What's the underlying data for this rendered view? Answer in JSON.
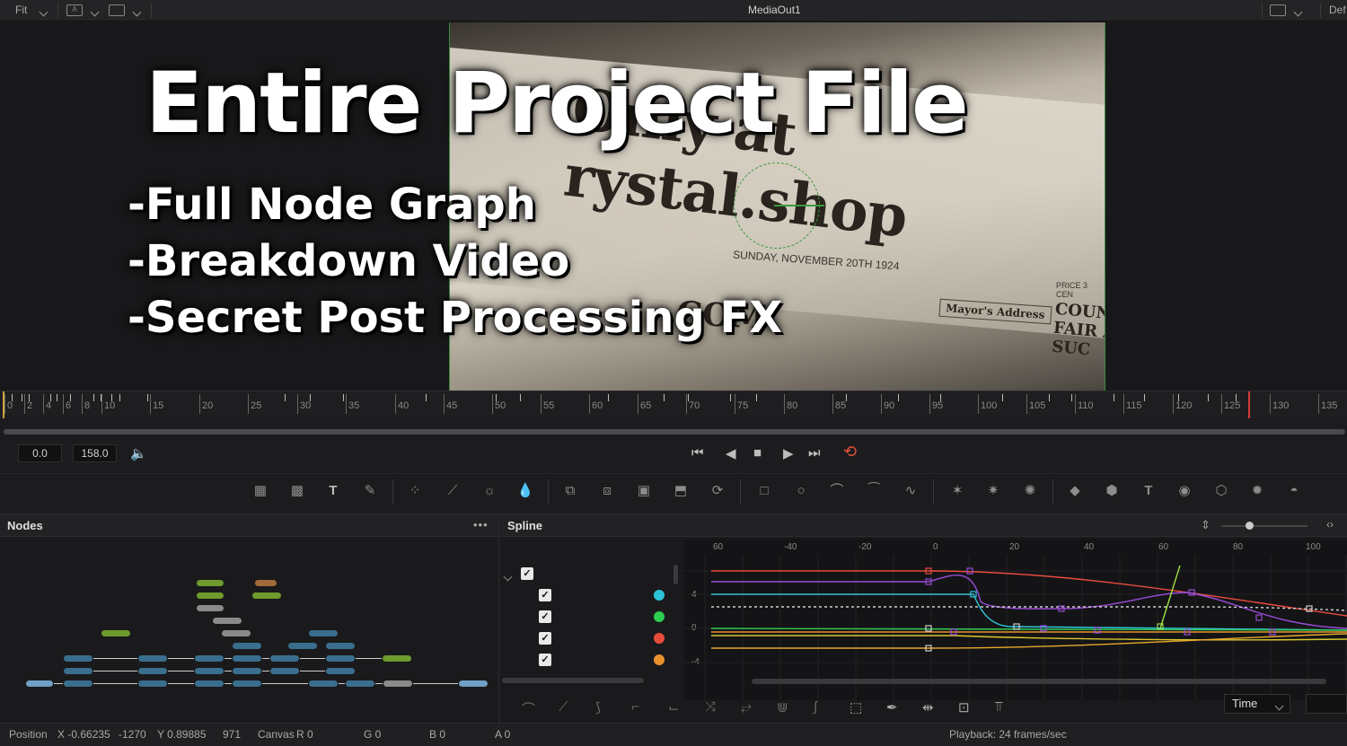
{
  "topbar": {
    "zoom": "Fit",
    "title": "MediaOut1",
    "right_label": "Def"
  },
  "overlay": {
    "title": "Entire Project File",
    "lines": [
      "-Full Node Graph",
      "-Breakdown Video",
      "-Secret Post Processing FX"
    ]
  },
  "newspaper": {
    "brand": "Only at rystal.shop",
    "date": "SUNDAY, NOVEMBER 20TH 1924",
    "domain": ".COM",
    "mayor": "Mayor's Address",
    "count": "COUNT FAIR A SUC",
    "price": "PRICE 3 CEN"
  },
  "ruler": {
    "labels": [
      "0",
      "2",
      "4",
      "6",
      "8",
      "10",
      "15",
      "20",
      "25",
      "30",
      "35",
      "40",
      "45",
      "50",
      "55",
      "60",
      "65",
      "70",
      "75",
      "80",
      "85",
      "90",
      "95",
      "100",
      "105",
      "110",
      "115",
      "120",
      "125",
      "130",
      "135"
    ]
  },
  "transport": {
    "current_time": "0.0",
    "end_time": "158.0"
  },
  "nodes_panel": {
    "title": "Nodes",
    "menu": "•••"
  },
  "spline_panel": {
    "title": "Spline",
    "x_labels": [
      "60",
      "-40",
      "-20",
      "0",
      "20",
      "40",
      "60",
      "80",
      "100"
    ],
    "y_labels": [
      "4",
      "0",
      "-4"
    ],
    "channel_colors": [
      "#2ec4d8",
      "#2ecc50",
      "#e84c3c",
      "#e8922e"
    ],
    "time_mode": "Time"
  },
  "status": {
    "position_label": "Position",
    "x": "X -0.66235",
    "x_px": "-1270",
    "y": "Y 0.89885",
    "y_px": "971",
    "canvas": "Canvas",
    "r": "R 0",
    "g": "G 0",
    "b": "B 0",
    "a": "A 0",
    "playback": "Playback: 24 frames/sec"
  }
}
